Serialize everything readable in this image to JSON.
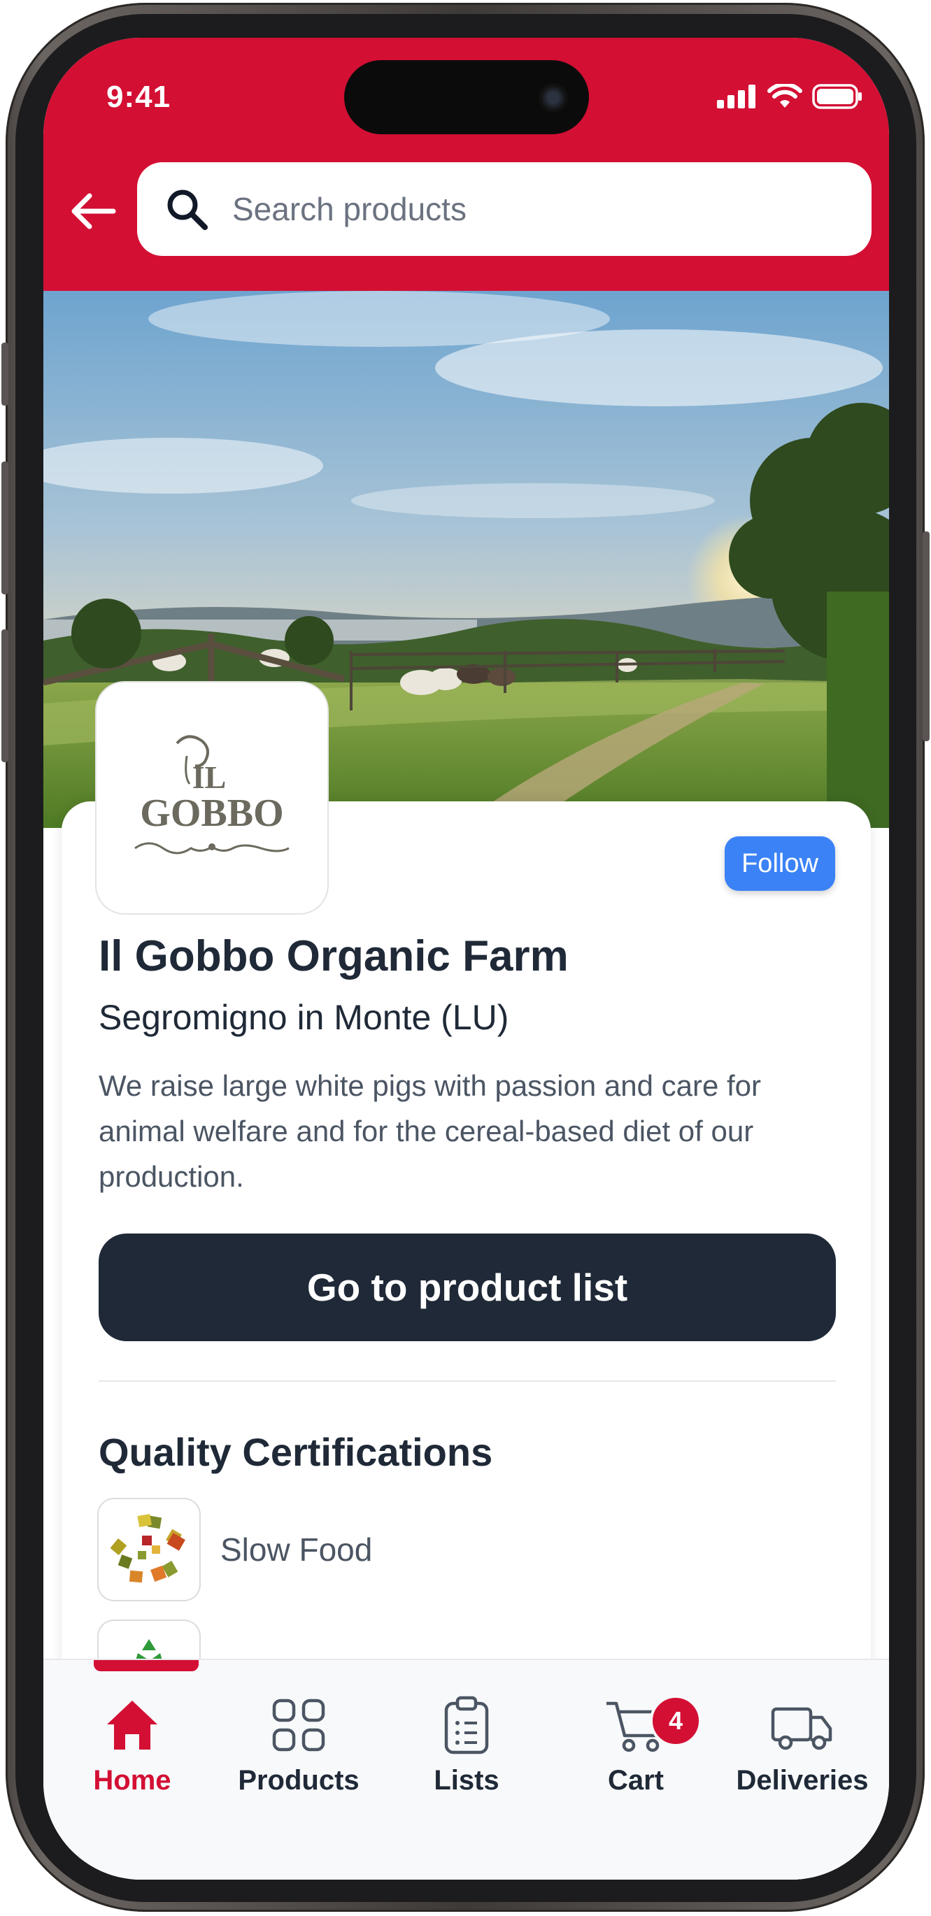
{
  "status_bar": {
    "time": "9:41"
  },
  "header": {
    "search_placeholder": "Search products"
  },
  "producer": {
    "logo_line1": "IL",
    "logo_line2": "GOBBO",
    "name": "Il Gobbo Organic Farm",
    "location": "Segromigno in Monte (LU)",
    "description": "We raise large white pigs with passion and care for animal welfare and for the cereal-based diet of our production.",
    "follow_label": "Follow",
    "cta_label": "Go to product list"
  },
  "certifications": {
    "title": "Quality Certifications",
    "items": [
      {
        "label": "Slow Food"
      }
    ]
  },
  "tabbar": {
    "accent": "#d30f34",
    "items": [
      {
        "label": "Home",
        "icon": "home-icon",
        "active": true
      },
      {
        "label": "Products",
        "icon": "grid-icon"
      },
      {
        "label": "Lists",
        "icon": "clipboard-icon"
      },
      {
        "label": "Cart",
        "icon": "cart-icon",
        "badge": "4"
      },
      {
        "label": "Deliveries",
        "icon": "truck-icon"
      }
    ]
  }
}
